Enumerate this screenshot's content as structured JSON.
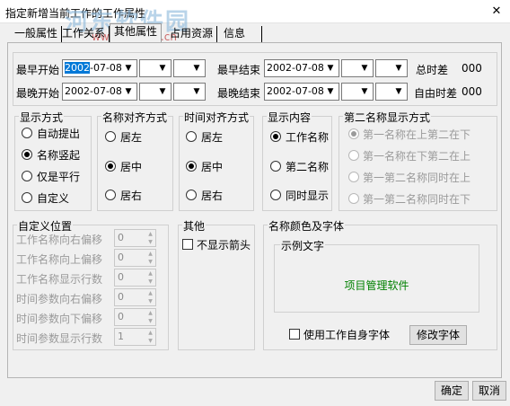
{
  "window": {
    "title": "指定新增当前工作的工作属性",
    "close": "✕"
  },
  "watermark": {
    "brand": "河东软件园",
    "url": "www.pc0359.cn"
  },
  "tabs": [
    {
      "label": "一般属性"
    },
    {
      "label": "工作关系"
    },
    {
      "label": "其他属性"
    },
    {
      "label": "占用资源"
    },
    {
      "label": "信息"
    }
  ],
  "dates": {
    "earliest_start": {
      "label": "最早开始",
      "date_year": "2002",
      "date_rest": "-07-08"
    },
    "earliest_end": {
      "label": "最早结束",
      "date": "2002-07-08"
    },
    "latest_start": {
      "label": "最晚开始",
      "date": "2002-07-08"
    },
    "latest_end": {
      "label": "最晚结束",
      "date": "2002-07-08"
    },
    "total_float": {
      "label": "总时差",
      "value": "000"
    },
    "free_float": {
      "label": "自由时差",
      "value": "000"
    }
  },
  "display_mode": {
    "title": "显示方式",
    "options": [
      "自动提出",
      "名称竖起",
      "仅是平行",
      "自定义"
    ],
    "selected": 1
  },
  "name_align": {
    "title": "名称对齐方式",
    "options": [
      "居左",
      "居中",
      "居右"
    ],
    "selected": 1
  },
  "time_align": {
    "title": "时间对齐方式",
    "options": [
      "居左",
      "居中",
      "居右"
    ],
    "selected": 1
  },
  "display_content": {
    "title": "显示内容",
    "options": [
      "工作名称",
      "第二名称",
      "同时显示"
    ],
    "selected": 0
  },
  "second_name_mode": {
    "title": "第二名称显示方式",
    "options": [
      "第一名称在上第二在下",
      "第一名称在下第二在上",
      "第一第二名称同时在上",
      "第一第二名称同时在下"
    ],
    "selected": 0
  },
  "custom_pos": {
    "title": "自定义位置",
    "fields": [
      {
        "label": "工作名称向右偏移",
        "value": "0"
      },
      {
        "label": "工作名称向上偏移",
        "value": "0"
      },
      {
        "label": "工作名称显示行数",
        "value": "0"
      },
      {
        "label": "时间参数向右偏移",
        "value": "0"
      },
      {
        "label": "时间参数向下偏移",
        "value": "0"
      },
      {
        "label": "时间参数显示行数",
        "value": "1"
      }
    ]
  },
  "other": {
    "title": "其他",
    "no_arrow_label": "不显示箭头"
  },
  "font_group": {
    "title": "名称颜色及字体",
    "sample_title": "示例文字",
    "sample_text": "项目管理软件",
    "use_own_font": "使用工作自身字体",
    "modify_font": "修改字体"
  },
  "buttons": {
    "ok": "确定",
    "cancel": "取消"
  }
}
